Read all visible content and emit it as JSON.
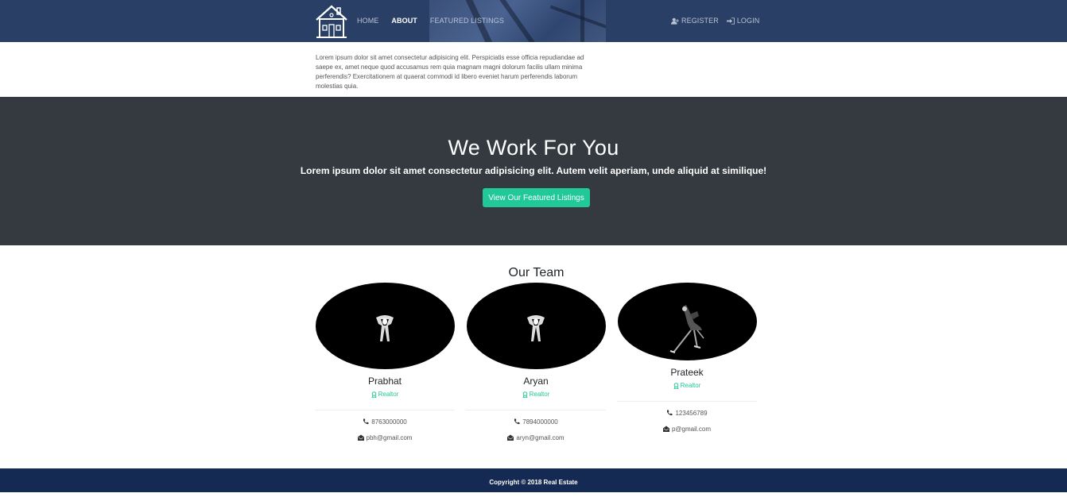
{
  "nav": {
    "links": [
      "HOME",
      "ABOUT",
      "FEATURED LISTINGS"
    ],
    "active": "ABOUT",
    "register": "REGISTER",
    "login": "LOGIN"
  },
  "about": {
    "text": "Lorem ipsum dolor sit amet consectetur adipisicing elit. Perspiciatis esse officia repudiandae ad saepe ex, amet neque quod accusamus rem quia magnam magni dolorum facilis ullam minima perferendis? Exercitationem at quaerat commodi id libero eveniet harum perferendis laborum molestias quia."
  },
  "work": {
    "title": "We Work For You",
    "subtitle": "Lorem ipsum dolor sit amet consectetur adipisicing elit. Autem velit aperiam, unde aliquid at similique!",
    "button": "View Our Featured Listings"
  },
  "team": {
    "title": "Our Team",
    "members": [
      {
        "name": "Prabhat",
        "role": "Realtor",
        "phone": "8763000000",
        "email": "pbh@gmail.com"
      },
      {
        "name": "Aryan",
        "role": "Realtor",
        "phone": "7894000000",
        "email": "aryn@gmail.com"
      },
      {
        "name": "Prateek",
        "role": "Realtor",
        "phone": "123456789",
        "email": "p@gmail.com"
      }
    ]
  },
  "footer": {
    "text": "Copyright © 2018 Real Estate"
  },
  "colors": {
    "navbar": "#2a3f66",
    "dark_section": "#343a40",
    "accent": "#20c997",
    "footer": "#142a52"
  },
  "icons": {
    "register": "user-plus-icon",
    "login": "sign-in-icon",
    "role": "award-icon",
    "phone": "phone-icon",
    "email": "envelope-open-icon"
  }
}
